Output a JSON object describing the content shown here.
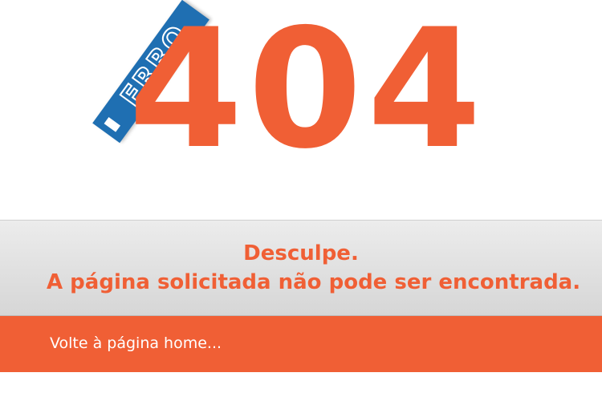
{
  "logo": {
    "badge_text": "ERRO",
    "code": "404",
    "badge_color": "#1f6fb2",
    "code_color": "#f05f35"
  },
  "message": {
    "title": "Desculpe.",
    "subtitle": "A página solicitada não pode ser encontrada."
  },
  "footer": {
    "home_link": "Volte à página home..."
  },
  "colors": {
    "accent": "#f05f35",
    "band_gray": "#e0e0e0"
  }
}
